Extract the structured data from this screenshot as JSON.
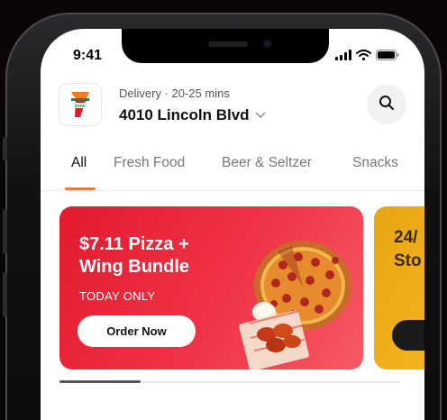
{
  "status_bar": {
    "time": "9:41"
  },
  "header": {
    "logo_top": "7",
    "logo_word": "now",
    "delivery_info": "Delivery · 20-25 mins",
    "address": "4010 Lincoln Blvd"
  },
  "tabs": [
    {
      "label": "All",
      "active": true
    },
    {
      "label": "Fresh Food",
      "active": false
    },
    {
      "label": "Beer & Seltzer",
      "active": false
    },
    {
      "label": "Snacks",
      "active": false
    }
  ],
  "promos": [
    {
      "title_line1": "$7.11 Pizza +",
      "title_line2": "Wing Bundle",
      "subtitle": "TODAY ONLY",
      "button_label": "Order Now",
      "color": "#e21a2e"
    },
    {
      "title_line1": "24/",
      "title_line2": "Sto",
      "color": "#f3b521"
    }
  ],
  "colors": {
    "accent": "#f4743b",
    "brand_red": "#e21a2e",
    "brand_green": "#1a8a3e",
    "brand_orange": "#f47b20"
  },
  "icons": {
    "search": "search-icon",
    "chevron": "chevron-down-icon",
    "signal": "signal-icon",
    "wifi": "wifi-icon",
    "battery": "battery-icon"
  }
}
